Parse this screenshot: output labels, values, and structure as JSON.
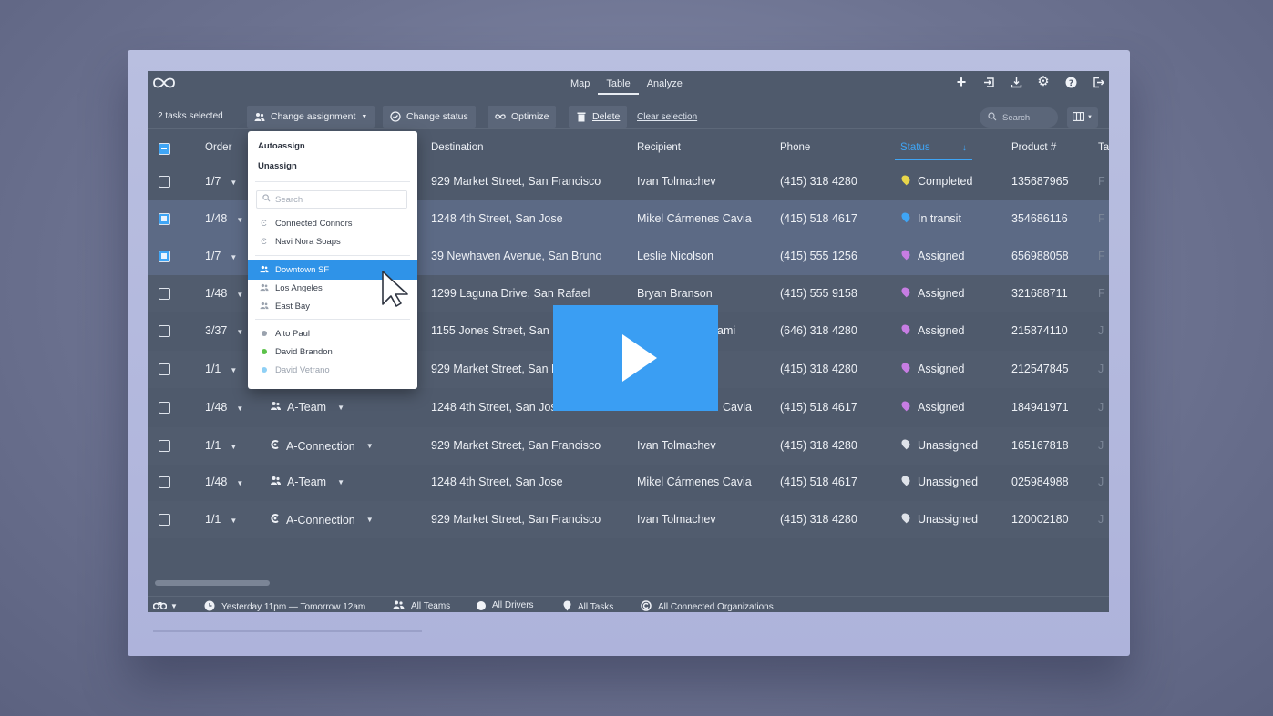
{
  "nav": {
    "tabs": [
      "Map",
      "Table",
      "Analyze"
    ],
    "active": "Table"
  },
  "toolbar": {
    "selected_count": "2 tasks selected",
    "change_assignment": "Change assignment",
    "change_status": "Change status",
    "optimize": "Optimize",
    "delete": "Delete",
    "clear_selection": "Clear selection",
    "search_placeholder": "Search"
  },
  "table": {
    "columns": [
      "Order",
      "Destination",
      "Recipient",
      "Phone",
      "Status",
      "Product #",
      "Ta"
    ],
    "rows": [
      {
        "order": "1/7",
        "assignee": "",
        "destination": "929 Market Street, San Francisco",
        "recipient": "Ivan Tolmachev",
        "phone": "(415) 318 4280",
        "status": "Completed",
        "product": "135687965",
        "checked": false
      },
      {
        "order": "1/48",
        "assignee": "",
        "destination": "1248 4th Street, San Jose",
        "recipient": "Mikel Cármenes Cavia",
        "phone": "(415) 518 4617",
        "status": "In transit",
        "product": "354686116",
        "checked": true
      },
      {
        "order": "1/7",
        "assignee": "",
        "destination": "39 Newhaven Avenue, San Bruno",
        "recipient": "Leslie Nicolson",
        "phone": "(415) 555 1256",
        "status": "Assigned",
        "product": "656988058",
        "checked": true
      },
      {
        "order": "1/48",
        "assignee": "",
        "destination": "1299 Laguna Drive, San Rafael",
        "recipient": "Bryan Branson",
        "phone": "(415) 555 9158",
        "status": "Assigned",
        "product": "321688711",
        "checked": false
      },
      {
        "order": "3/37",
        "assignee": "",
        "destination": "1155 Jones Street, San",
        "recipient": "ami",
        "phone": "(646) 318 4280",
        "status": "Assigned",
        "product": "215874110",
        "checked": false
      },
      {
        "order": "1/1",
        "assignee": "",
        "destination": "929 Market Street, San F",
        "recipient": "",
        "phone": "(415) 318 4280",
        "status": "Assigned",
        "product": "212547845",
        "checked": false
      },
      {
        "order": "1/48",
        "assignee": "A-Team",
        "destination": "1248 4th Street, San Jose",
        "recipient": "Cavia",
        "phone": "(415) 518 4617",
        "status": "Assigned",
        "product": "184941971",
        "checked": false
      },
      {
        "order": "1/1",
        "assignee": "A-Connection",
        "destination": "929 Market Street, San Francisco",
        "recipient": "Ivan Tolmachev",
        "phone": "(415) 318 4280",
        "status": "Unassigned",
        "product": "165167818",
        "checked": false
      },
      {
        "order": "1/48",
        "assignee": "A-Team",
        "destination": "1248 4th Street, San Jose",
        "recipient": "Mikel Cármenes Cavia",
        "phone": "(415) 518 4617",
        "status": "Unassigned",
        "product": "025984988",
        "checked": false
      },
      {
        "order": "1/1",
        "assignee": "A-Connection",
        "destination": "929 Market Street, San Francisco",
        "recipient": "Ivan Tolmachev",
        "phone": "(415) 318 4280",
        "status": "Unassigned",
        "product": "120002180",
        "checked": false
      }
    ]
  },
  "dropdown": {
    "autoassign": "Autoassign",
    "unassign": "Unassign",
    "search_placeholder": "Search",
    "orgs": [
      "Connected Connors",
      "Navi Nora Soaps"
    ],
    "teams": [
      "Downtown SF",
      "Los Angeles",
      "East Bay"
    ],
    "highlighted": "Downtown SF",
    "drivers": [
      "Alto Paul",
      "David Brandon",
      "David Vetrano"
    ]
  },
  "statusbar": {
    "time_range": "Yesterday 11pm — Tomorrow 12am",
    "teams": "All Teams",
    "drivers": "All Drivers",
    "tasks": "All Tasks",
    "orgs": "All Connected Organizations"
  },
  "colors": {
    "accent": "#3fa5f5",
    "completed": "#e8d64a",
    "in_transit": "#3fa5f5",
    "assigned": "#c77de3",
    "unassigned": "#dfe3ea",
    "driver_alto": "#9aa2ae",
    "driver_brandon": "#5cc24a",
    "driver_vetrano": "#8fd0f5"
  }
}
